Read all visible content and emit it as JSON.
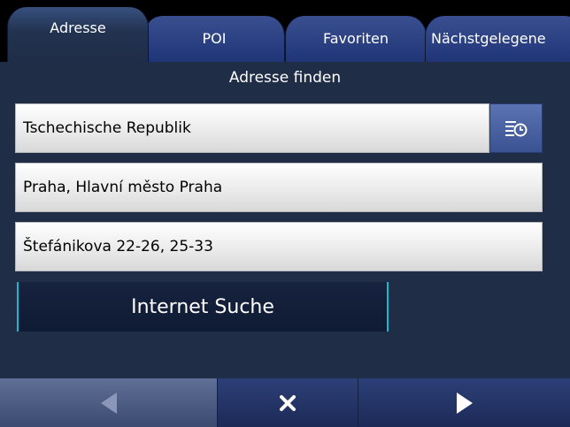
{
  "tabs": {
    "adresse": "Adresse",
    "poi": "POI",
    "favoriten": "Favoriten",
    "naechstgelegene": "Nächstgelegene"
  },
  "section": {
    "title": "Adresse finden"
  },
  "fields": {
    "country": "Tschechische Republik",
    "city": "Praha, Hlavní město Praha",
    "street": "Štefánikova 22-26, 25-33"
  },
  "buttons": {
    "internet_search": "Internet Suche"
  },
  "icons": {
    "history": "history-list-icon",
    "back": "back-arrow-icon",
    "close": "close-icon",
    "next": "next-arrow-icon"
  },
  "colors": {
    "background": "#1f2d47",
    "tab": "#2c4288",
    "accent": "#1ab7d0"
  }
}
